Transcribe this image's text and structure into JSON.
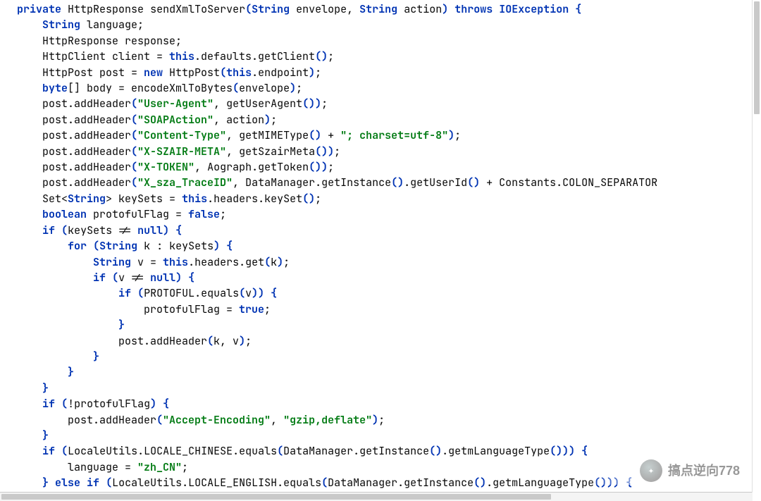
{
  "code": {
    "method_modifier": "private",
    "return_type": "HttpResponse",
    "method_name": "sendXmlToServer",
    "param1_type": "String",
    "param1_name": "envelope",
    "param2_type": "String",
    "param2_name": "action",
    "throws_kw": "throws",
    "throws_type": "IOException",
    "l2": "String language;",
    "l3": "HttpResponse response;",
    "l4_a": "HttpClient client = ",
    "l4_b": ".defaults.getClient",
    "l5_a": "HttpPost post = ",
    "l5_b": " HttpPost",
    "l5_c": ".endpoint",
    "l6_a": "[] body = encodeXmlToBytes",
    "l6_b": "envelope",
    "l7_a": "post.addHeader",
    "l7_s": "\"User-Agent\"",
    "l7_b": ", getUserAgent",
    "l8_s": "\"SOAPAction\"",
    "l8_b": ", action",
    "l9_s": "\"Content-Type\"",
    "l9_b": ", getMIMEType",
    "l9_c": " + ",
    "l9_d": "\"; charset=utf-8\"",
    "l10_s": "\"X-SZAIR-META\"",
    "l10_b": ", getSzairMeta",
    "l11_s": "\"X-TOKEN\"",
    "l11_b": ", Aograph.getToken",
    "l12_s": "\"X_sza_TraceID\"",
    "l12_b": ", DataManager.getInstance",
    "l12_c": ".getUserId",
    "l12_d": " + Constants.COLON_SEPARATOR",
    "l13_a": "Set<",
    "l13_b": "> keySets = ",
    "l13_c": ".headers.keySet",
    "l14_a": " protofulFlag = ",
    "l15_a": "keySets != ",
    "l16_a": " k : keySets",
    "l17_a": " v = ",
    "l17_b": ".headers.get",
    "l17_c": "k",
    "l18_a": "v != ",
    "l19_a": "PROTOFUL.equals",
    "l19_b": "v",
    "l20_a": "protofulFlag = ",
    "l21_a": "post.addHeader",
    "l21_b": "k, v",
    "l25_a": "!protofulFlag",
    "l26_a": "post.addHeader",
    "l26_s1": "\"Accept-Encoding\"",
    "l26_s2": "\"gzip,deflate\"",
    "l28_a": "LocaleUtils.LOCALE_CHINESE.equals",
    "l28_b": "DataManager.getInstance",
    "l28_c": ".getmLanguageType",
    "l29_a": "language = ",
    "l29_s": "\"zh_CN\"",
    "l30_a": "LocaleUtils.LOCALE_ENGLISH.equals",
    "l30_b": "DataManager.getInstance",
    "l30_c": ".getmLanguageType",
    "kw_new": "new",
    "kw_this": "this",
    "kw_byte": "byte",
    "kw_boolean": "boolean",
    "kw_false": "false",
    "kw_true": "true",
    "kw_if": "if",
    "kw_for": "for",
    "kw_null": "null",
    "kw_elseif": "else if",
    "type_string": "String"
  },
  "watermark": {
    "text": "搞点逆向778"
  }
}
